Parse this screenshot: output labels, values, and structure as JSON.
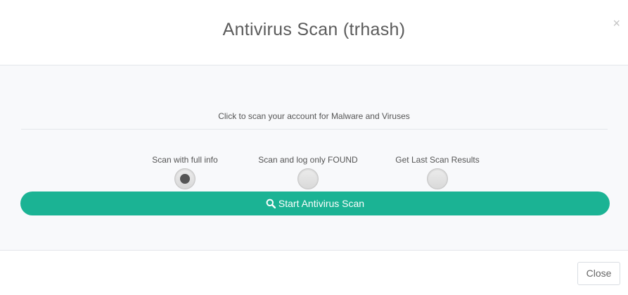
{
  "dialog": {
    "title": "Antivirus Scan (trhash)",
    "close_icon": "×"
  },
  "body": {
    "intro_text": "Click to scan your account for Malware and Viruses",
    "options": [
      {
        "label": "Scan with full info",
        "selected": true
      },
      {
        "label": "Scan and log only FOUND",
        "selected": false
      },
      {
        "label": "Get Last Scan Results",
        "selected": false
      }
    ],
    "start_button": {
      "icon": "search-icon",
      "label": "Start Antivirus Scan"
    }
  },
  "footer": {
    "close_label": "Close"
  },
  "colors": {
    "accent": "#1bb394",
    "body_background": "#f8f9fb"
  }
}
